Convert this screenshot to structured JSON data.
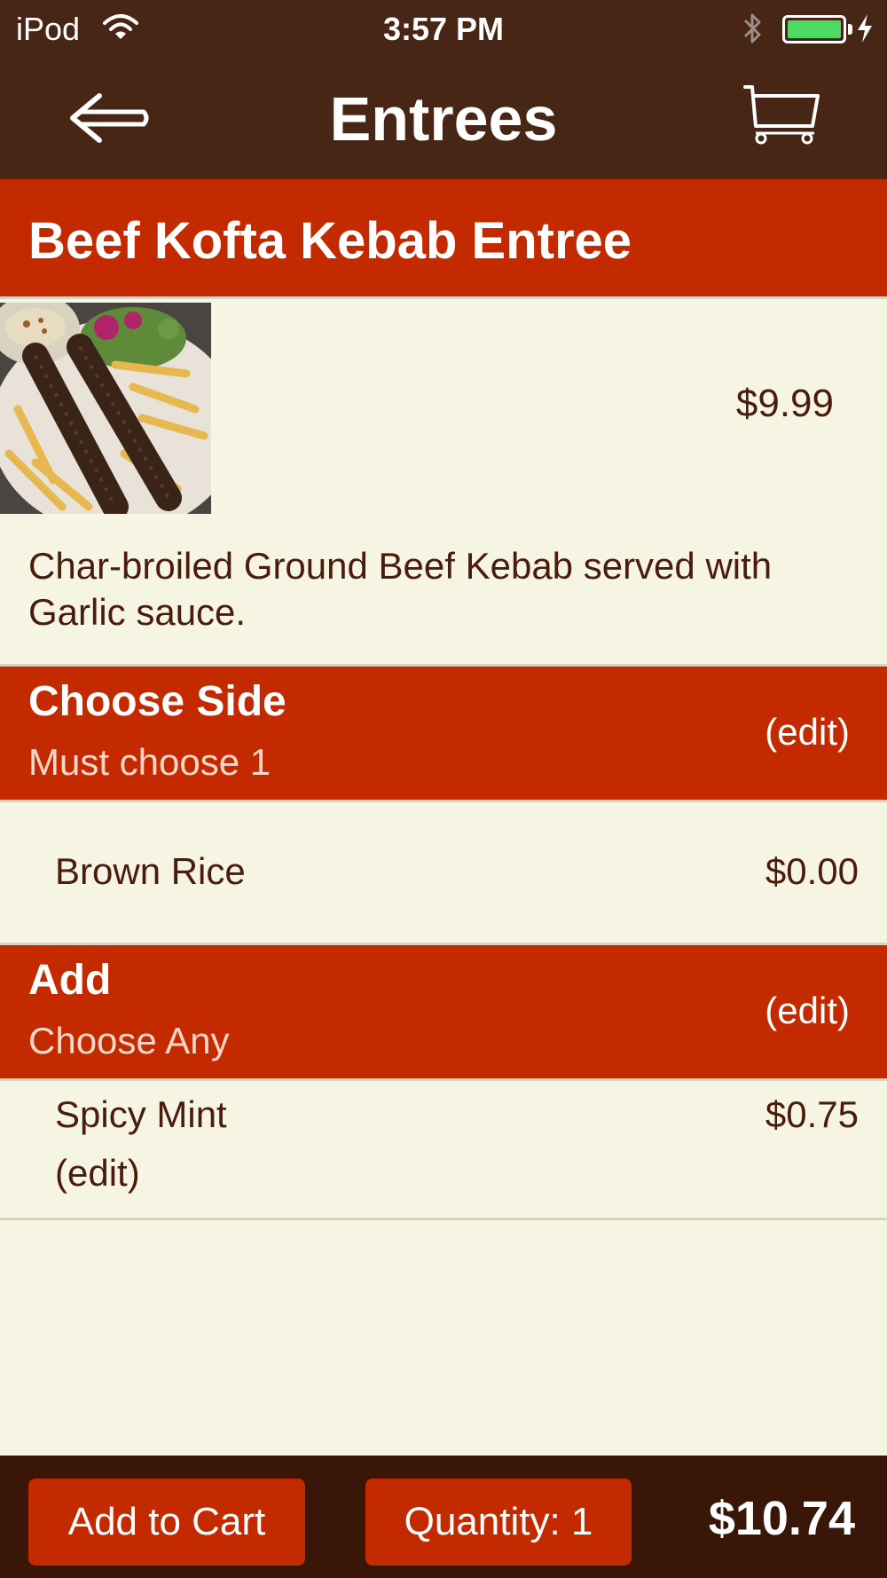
{
  "status": {
    "carrier": "iPod",
    "time": "3:57 PM",
    "battery_level": 1.0,
    "wifi_icon": "wifi-icon",
    "bluetooth_icon": "bluetooth-icon",
    "charging_icon": "charging-bolt-icon"
  },
  "nav": {
    "title": "Entrees",
    "back_icon": "back-arrow-icon",
    "cart_icon": "cart-icon"
  },
  "item": {
    "name": "Beef Kofta Kebab Entree",
    "price": "$9.99",
    "description": "Char-broiled Ground Beef Kebab served with Garlic sauce."
  },
  "sections": [
    {
      "title": "Choose Side",
      "subtitle": "Must choose 1",
      "edit_label": "(edit)",
      "options": [
        {
          "name": "Brown Rice",
          "price": "$0.00"
        }
      ]
    },
    {
      "title": "Add",
      "subtitle": "Choose Any",
      "edit_label": "(edit)",
      "options": [
        {
          "name": "Spicy Mint",
          "price": "$0.75",
          "edit_label": "(edit)"
        }
      ]
    }
  ],
  "footer": {
    "add_to_cart_label": "Add to Cart",
    "quantity_label": "Quantity: 1",
    "total": "$10.74"
  },
  "colors": {
    "header_brown": "#482616",
    "accent_red": "#c42a00",
    "background_cream": "#f6f5e3",
    "text_brown": "#4a1c0c",
    "footer_dark": "#3a1608"
  }
}
